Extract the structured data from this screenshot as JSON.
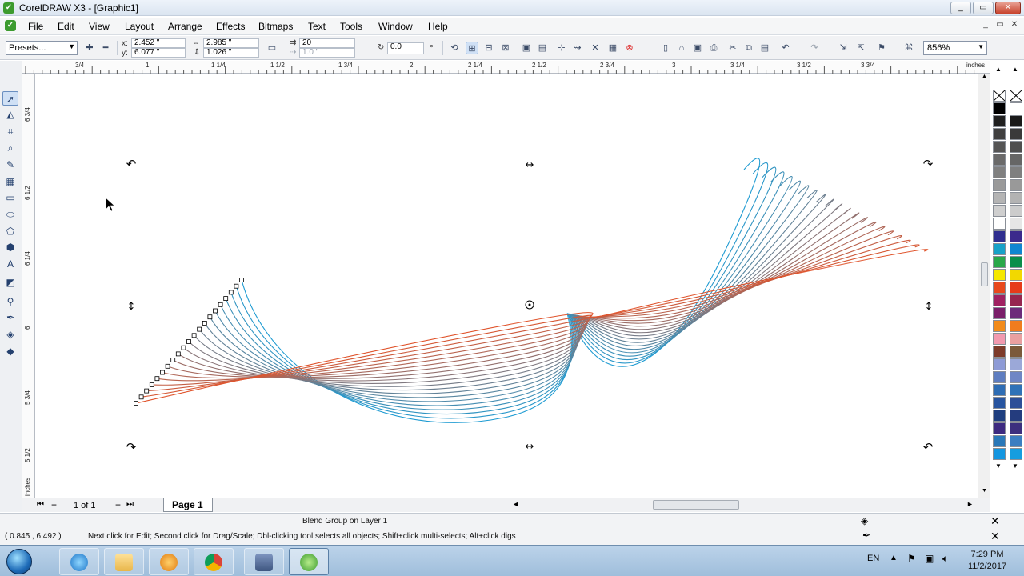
{
  "window": {
    "title": "CorelDRAW X3 - [Graphic1]",
    "controls": [
      "_",
      "▭",
      "✕"
    ],
    "doc_controls": [
      "_",
      "▭",
      "✕"
    ]
  },
  "menu": [
    "File",
    "Edit",
    "View",
    "Layout",
    "Arrange",
    "Effects",
    "Bitmaps",
    "Text",
    "Tools",
    "Window",
    "Help"
  ],
  "propbar": {
    "presets": "Presets...",
    "x_label": "x:",
    "x_value": "2.452 \"",
    "y_label": "y:",
    "y_value": "6.077 \"",
    "w_value": "2.985 \"",
    "h_value": "1.026 \"",
    "steps_value": "20",
    "offset_value": "1.0 \"",
    "angle_value": "0.0",
    "angle_unit": "°",
    "zoom": "856%"
  },
  "ruler": {
    "unit": "inches",
    "h_ticks": [
      "3/4",
      "1",
      "1 1/4",
      "1 1/2",
      "1 3/4",
      "2",
      "2 1/4",
      "2 1/2",
      "2 3/4",
      "3",
      "3 1/4",
      "3 1/2",
      "3 3/4"
    ],
    "v_ticks": [
      "6 3/4",
      "6 1/2",
      "6 1/4",
      "6",
      "5 3/4",
      "5 1/2"
    ],
    "v_unit": "inches"
  },
  "pages": {
    "counter": "1 of 1",
    "tab": "Page 1"
  },
  "status": {
    "selection": "Blend Group on Layer 1",
    "coords": "( 0.845 , 6.492 )",
    "hint": "Next click for Edit; Second click for Drag/Scale; Dbl-clicking tool selects all objects; Shift+click multi-selects; Alt+click digs"
  },
  "taskbar": {
    "items": [
      "Internet Explorer",
      "Windows Explorer",
      "Media Player",
      "Google Chrome",
      "Save",
      "CorelDRAW"
    ],
    "lang": "EN",
    "time": "7:29 PM",
    "date": "11/2/2017"
  },
  "colors": {
    "blend_start": "#1e9bd2",
    "blend_end": "#e0542c",
    "palette_left": [
      "#000000",
      "#202020",
      "#404040",
      "#555555",
      "#6a6a6a",
      "#808080",
      "#9a9a9a",
      "#b4b4b4",
      "#cfcfcf",
      "#ffffff",
      "#2f2f8f",
      "#18a2c8",
      "#2aa84a",
      "#f5e800",
      "#e8491d",
      "#a02262",
      "#7b1f6a",
      "#f28c1c",
      "#f29ab0",
      "#7d3b2a",
      "#8e9bd6",
      "#5e7dc0",
      "#2e6db4",
      "#2855a0",
      "#1f3f80",
      "#3d2a80",
      "#2a78b8",
      "#1596e0"
    ],
    "palette_right": [
      "#ffffff",
      "#1a1a1a",
      "#3a3a3a",
      "#4f4f4f",
      "#666666",
      "#7f7f7f",
      "#999999",
      "#b3b3b3",
      "#cccccc",
      "#e6e6e6",
      "#3b2a8c",
      "#0f86d1",
      "#0a8e4a",
      "#f2d800",
      "#e63b1a",
      "#96264f",
      "#6d2c7a",
      "#f07c1e",
      "#e9a0a0",
      "#7b5a3a",
      "#9ba8d8",
      "#6f86c5",
      "#2f72b7",
      "#2d4f98",
      "#243c7e",
      "#3c2f7e",
      "#3b7ec1",
      "#159ddf"
    ]
  }
}
